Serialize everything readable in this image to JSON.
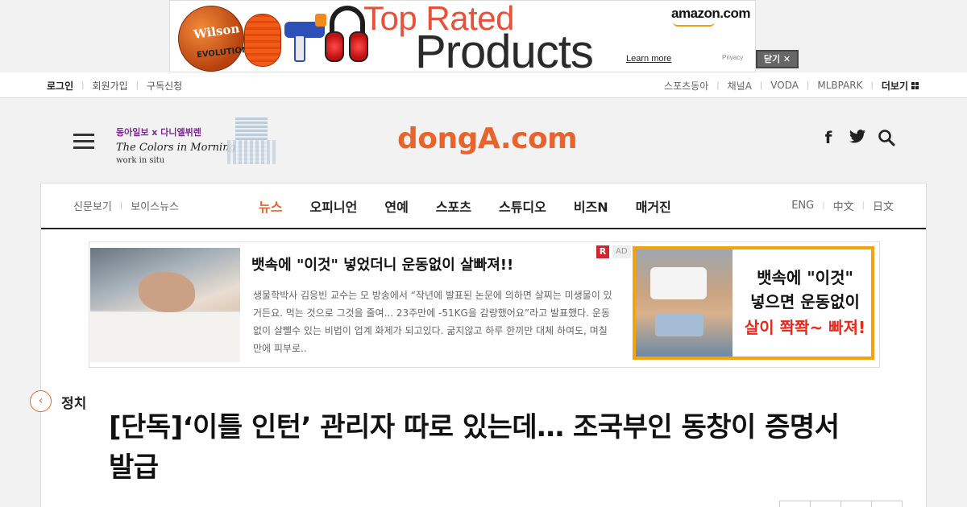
{
  "top_ad": {
    "line1": "Top Rated",
    "line2": "Products",
    "brand": "amazon.com",
    "learn_more": "Learn more",
    "privacy": "Privacy",
    "ball_text": "Wilson",
    "ball_sub": "EVOLUTION",
    "close_label": "닫기 ✕"
  },
  "util_bar": {
    "login": "로그인",
    "signup": "회원가입",
    "subscribe": "구독신청",
    "links": [
      "스포츠동아",
      "채널A",
      "VODA",
      "MLBPARK"
    ],
    "more": "더보기"
  },
  "header": {
    "promo_line1": "동아일보 x 다니엘뷔렌",
    "promo_line2": "The Colors in Morning Calm",
    "promo_line3": "work in situ",
    "logo": "dongA.com",
    "facebook_icon": "f",
    "twitter_icon": "🐦",
    "search_icon": "⌕"
  },
  "nav": {
    "left": [
      "신문보기",
      "보이스뉴스"
    ],
    "main": [
      "뉴스",
      "오피니언",
      "연예",
      "스포츠",
      "스튜디오",
      "비즈N",
      "매거진"
    ],
    "active": "뉴스",
    "right": [
      "ENG",
      "中文",
      "日文"
    ]
  },
  "content_ad": {
    "title": "뱃속에 \"이것\" 넣었더니 운동없이 살빠져!!",
    "description": "생물학박사 김응빈 교수는 모 방송에서 “작년에 발표된 논문에 의하면 살찌는 미생물이 있거든요. 먹는 것으로 그것을 줄여... 23주만에 -51KG을 감량했어요”라고 발표했다. 운동없이 살뺄수 있는 비법이 업계 화제가 되고있다. 굶지않고 하루 한끼만 대체 하여도, 며칠 만에 피부로..",
    "badge_r": "R",
    "badge_ad": "AD",
    "right_line1": "뱃속에 \"이것\"",
    "right_line2": "넣으면 운동없이",
    "right_line3": "살이 쫙쫙~ 빠져!"
  },
  "article": {
    "back_icon": "‹",
    "section": "정치",
    "title": "[단독]‘이틀 인턴’ 관리자 따로 있는데… 조국부인 동창이 증명서 발급"
  },
  "colors": {
    "brand": "#e8642c",
    "ad_border": "#f5a30a",
    "ad_highlight": "#e8281c"
  }
}
